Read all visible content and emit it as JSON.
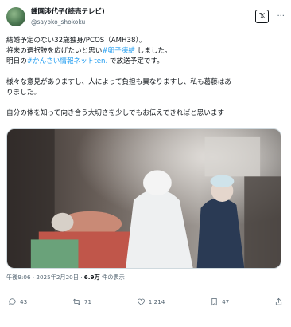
{
  "author": {
    "display_name": "鍾園渉代子(読売テレビ)",
    "handle": "@sayoko_shokoku"
  },
  "header": {
    "x_button_label": "𝕏",
    "more_label": "···"
  },
  "tweet": {
    "line1": "結婚予定のない32歳独身/PCOS（AMH38）。",
    "line2_pre": "将来の選択肢を広げたいと思い",
    "line2_tag": "#卵子凍結",
    "line2_post": " しました。",
    "line3_pre": "明日の",
    "line3_tag": "#かんさい情報ネットten.",
    "line3_post": " で放送予定です。",
    "line4": "様々な意見がありますし、人によって負担も異なりますし、私も葛藤はあ",
    "line5": "りました。",
    "line6": "自分の体を知って向き合う大切さを少しでもお伝えできればと思います"
  },
  "meta": {
    "time": "午後9:06 · 2025年2月20日 · ",
    "views_count": "6.9万",
    "views_label": " 件の表示"
  },
  "actions": {
    "replies": "43",
    "retweets": "71",
    "likes": "1,214",
    "bookmarks": "47"
  },
  "colors": {
    "accent": "#1d9bf0",
    "text": "#0f1419",
    "muted": "#536471"
  }
}
